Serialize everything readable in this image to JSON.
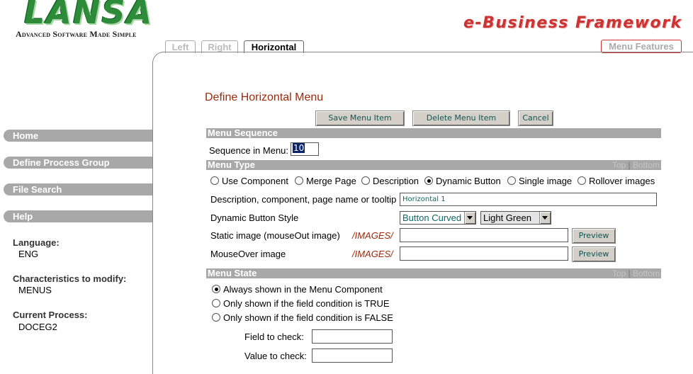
{
  "brand": {
    "logo_text": "LANSA",
    "tagline": "Advanced Software Made Simple",
    "product": "e-Business Framework"
  },
  "tabs": [
    {
      "label": "Left",
      "active": false
    },
    {
      "label": "Right",
      "active": false
    },
    {
      "label": "Horizontal",
      "active": true
    }
  ],
  "menu_features_label": "Menu Features",
  "sidebar": {
    "nav": [
      "Home",
      "Define Process Group",
      "File Search",
      "Help"
    ],
    "info": [
      {
        "label": "Language:",
        "value": "ENG"
      },
      {
        "label": "Characteristics to modify:",
        "value": "MENUS"
      },
      {
        "label": "Current Process:",
        "value": "DOCEG2"
      }
    ]
  },
  "form": {
    "title": "Define Horizontal Menu",
    "buttons": {
      "save": "Save Menu Item",
      "delete": "Delete Menu Item",
      "cancel": "Cancel"
    },
    "sections": {
      "sequence": {
        "title": "Menu Sequence"
      },
      "type": {
        "title": "Menu Type",
        "top": "Top",
        "sep": "|",
        "bottom": "Bottom"
      },
      "state": {
        "title": "Menu State",
        "top": "Top",
        "sep": "|",
        "bottom": "Bottom"
      }
    },
    "sequence_label": "Sequence in Menu:",
    "sequence_value": "10",
    "menu_types": [
      "Use Component",
      "Merge Page",
      "Description",
      "Dynamic Button",
      "Single image",
      "Rollover images"
    ],
    "menu_type_selected": "Dynamic Button",
    "description_label": "Description, component, page name or tooltip",
    "description_value": "Horizontal 1",
    "dynamic_style_label": "Dynamic Button Style",
    "style_shape": "Button Curved",
    "style_color": "Light Green",
    "static_image_label": "Static image (mouseOut image)",
    "mouseover_label": "MouseOver image",
    "image_path": "/IMAGES/",
    "static_image_value": "",
    "mouseover_value": "",
    "preview_label": "Preview",
    "states": [
      "Always shown in the Menu Component",
      "Only shown if the field condition is TRUE",
      "Only shown if the field condition is FALSE"
    ],
    "state_selected": 0,
    "field_to_check_label": "Field to check:",
    "value_to_check_label": "Value to check:",
    "field_to_check_value": "",
    "value_to_check_value": ""
  },
  "colors": {
    "accent_red": "#a0290a",
    "sidebar_gray": "#a8a8a8",
    "logo_green": "#2e8b3a"
  }
}
